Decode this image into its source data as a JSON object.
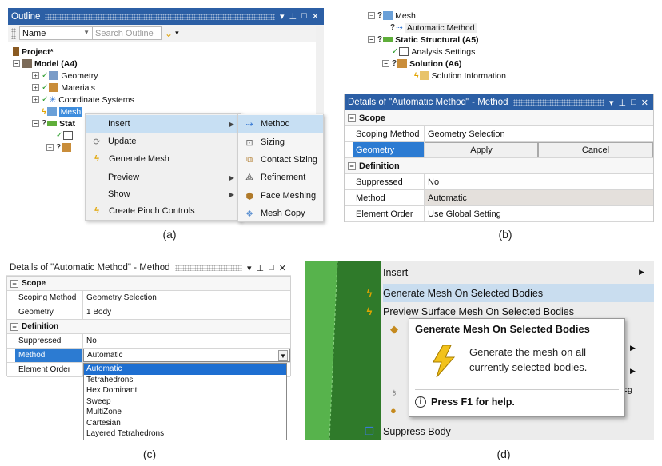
{
  "panel_a": {
    "caption": "(a)",
    "title": "Outline",
    "toolbar": {
      "name_combo": "Name",
      "search_placeholder": "Search Outline"
    },
    "tree": {
      "project": "Project*",
      "model": "Model (A4)",
      "geometry": "Geometry",
      "materials": "Materials",
      "coordinate_systems": "Coordinate Systems",
      "mesh": "Mesh",
      "static_partial": "Stat"
    },
    "context_menu": [
      "Insert",
      "Update",
      "Generate Mesh",
      "Preview",
      "Show",
      "Create Pinch Controls"
    ],
    "submenu": [
      "Method",
      "Sizing",
      "Contact Sizing",
      "Refinement",
      "Face Meshing",
      "Mesh Copy"
    ]
  },
  "panel_b": {
    "caption": "(b)",
    "tree": {
      "mesh": "Mesh",
      "automatic_method": "Automatic Method",
      "static_structural": "Static Structural (A5)",
      "analysis_settings": "Analysis Settings",
      "solution": "Solution (A6)",
      "solution_information": "Solution Information"
    },
    "details_title": "Details of \"Automatic Method\" - Method",
    "scope": "Scope",
    "scoping_method_label": "Scoping Method",
    "scoping_method_value": "Geometry Selection",
    "geometry_label": "Geometry",
    "apply": "Apply",
    "cancel": "Cancel",
    "definition": "Definition",
    "suppressed_label": "Suppressed",
    "suppressed_value": "No",
    "method_label": "Method",
    "method_value": "Automatic",
    "element_order_label": "Element Order",
    "element_order_value": "Use Global Setting"
  },
  "panel_c": {
    "caption": "(c)",
    "details_title": "Details of \"Automatic Method\" - Method",
    "scope": "Scope",
    "scoping_method_label": "Scoping Method",
    "scoping_method_value": "Geometry Selection",
    "geometry_label": "Geometry",
    "geometry_value": "1 Body",
    "definition": "Definition",
    "suppressed_label": "Suppressed",
    "suppressed_value": "No",
    "method_label": "Method",
    "method_value": "Automatic",
    "element_order_label": "Element Order",
    "options": [
      "Automatic",
      "Tetrahedrons",
      "Hex Dominant",
      "Sweep",
      "MultiZone",
      "Cartesian",
      "Layered Tetrahedrons"
    ]
  },
  "panel_d": {
    "caption": "(d)",
    "menu": {
      "insert": "Insert",
      "generate_selected": "Generate Mesh On Selected Bodies",
      "preview_surface": "Preview Surface Mesh On Selected Bodies",
      "shortcut_partial": "F9",
      "suppress_body": "Suppress Body"
    },
    "tooltip": {
      "title": "Generate Mesh On Selected Bodies",
      "body": "Generate the mesh on all currently selected bodies.",
      "help": "Press F1 for help."
    }
  }
}
